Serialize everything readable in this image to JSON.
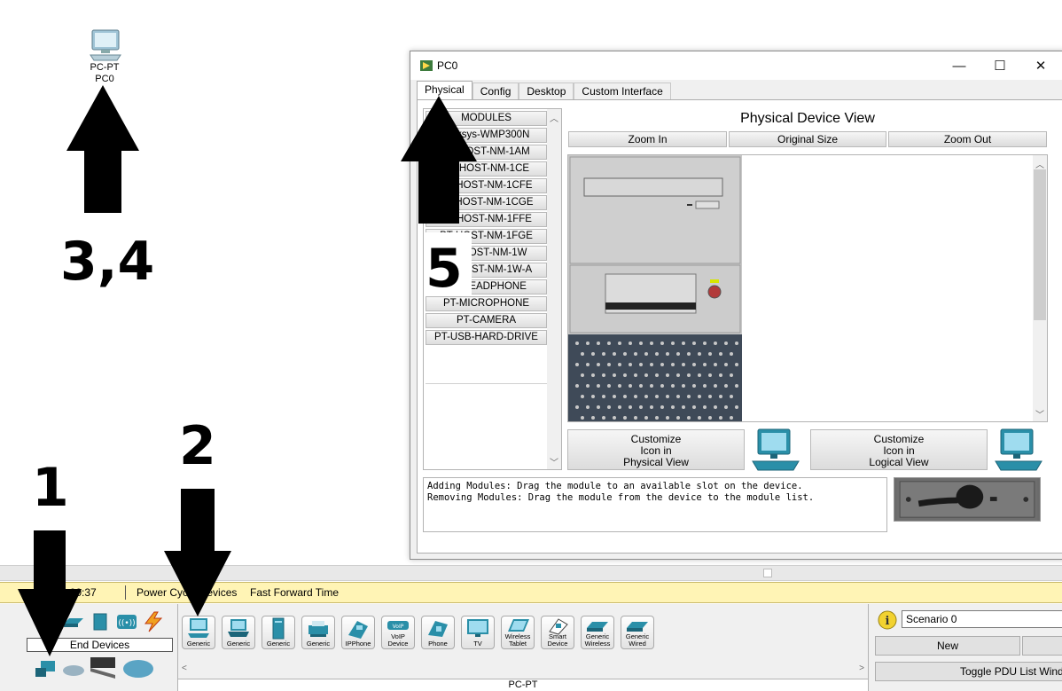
{
  "workspace": {
    "device_type": "PC-PT",
    "device_name": "PC0",
    "icon": "pc-icon"
  },
  "annotations": {
    "step_1": "1",
    "step_2": "2",
    "step_3_4": "3,4",
    "step_5": "5"
  },
  "dialog": {
    "title": "PC0",
    "controls": {
      "minimize": "—",
      "maximize": "☐",
      "close": "✕"
    },
    "tabs": [
      "Physical",
      "Config",
      "Desktop",
      "Custom Interface"
    ],
    "active_tab": "Physical",
    "modules": [
      "MODULES",
      "Linksys-WMP300N",
      "PT-HOST-NM-1AM",
      "PT-HOST-NM-1CE",
      "PT-HOST-NM-1CFE",
      "PT-HOST-NM-1CGE",
      "PT-HOST-NM-1FFE",
      "PT-HOST-NM-1FGE",
      "PT-HOST-NM-1W",
      "PT-HOST-NM-1W-A",
      "PT-HEADPHONE",
      "PT-MICROPHONE",
      "PT-CAMERA",
      "PT-USB-HARD-DRIVE"
    ],
    "view_title": "Physical Device View",
    "zoom_in": "Zoom In",
    "original_size": "Original Size",
    "zoom_out": "Zoom Out",
    "customize_physical": [
      "Customize",
      "Icon in",
      "Physical View"
    ],
    "customize_logical": [
      "Customize",
      "Icon in",
      "Logical View"
    ],
    "help_lines": [
      "Adding Modules: Drag the module to an available slot on the device.",
      "Removing Modules: Drag the module from the device to the module list."
    ]
  },
  "timebar": {
    "time": "00:00:37",
    "power_cycle": "Power Cycle Devices",
    "fast_forward": "Fast Forward Time"
  },
  "device_panel": {
    "category": "End Devices",
    "devices": [
      {
        "label": [
          "Generic"
        ],
        "icon": "pc-icon"
      },
      {
        "label": [
          "Generic"
        ],
        "icon": "laptop-icon"
      },
      {
        "label": [
          "Generic"
        ],
        "icon": "server-icon"
      },
      {
        "label": [
          "Generic"
        ],
        "icon": "printer-icon"
      },
      {
        "label": [
          "IPPhone"
        ],
        "icon": "ip-phone-icon"
      },
      {
        "label": [
          "VoIP",
          "Device"
        ],
        "icon": "voip-device-icon"
      },
      {
        "label": [
          "Phone"
        ],
        "icon": "phone-icon"
      },
      {
        "label": [
          "TV"
        ],
        "icon": "tv-icon"
      },
      {
        "label": [
          "Wireless",
          "Tablet"
        ],
        "icon": "tablet-icon"
      },
      {
        "label": [
          "Smart",
          "Device"
        ],
        "icon": "smart-device-icon"
      },
      {
        "label": [
          "Generic",
          "Wireless"
        ],
        "icon": "wireless-end-device-icon"
      },
      {
        "label": [
          "Generic",
          "Wired"
        ],
        "icon": "wired-end-device-icon"
      }
    ],
    "selected_name": "PC-PT"
  },
  "scenario": {
    "selected": "Scenario 0",
    "new_button": "New",
    "toggle_button": "Toggle PDU List Window"
  },
  "colors": {
    "device_teal": "#2a8fa8",
    "timebar_bg": "#fff4b5"
  }
}
